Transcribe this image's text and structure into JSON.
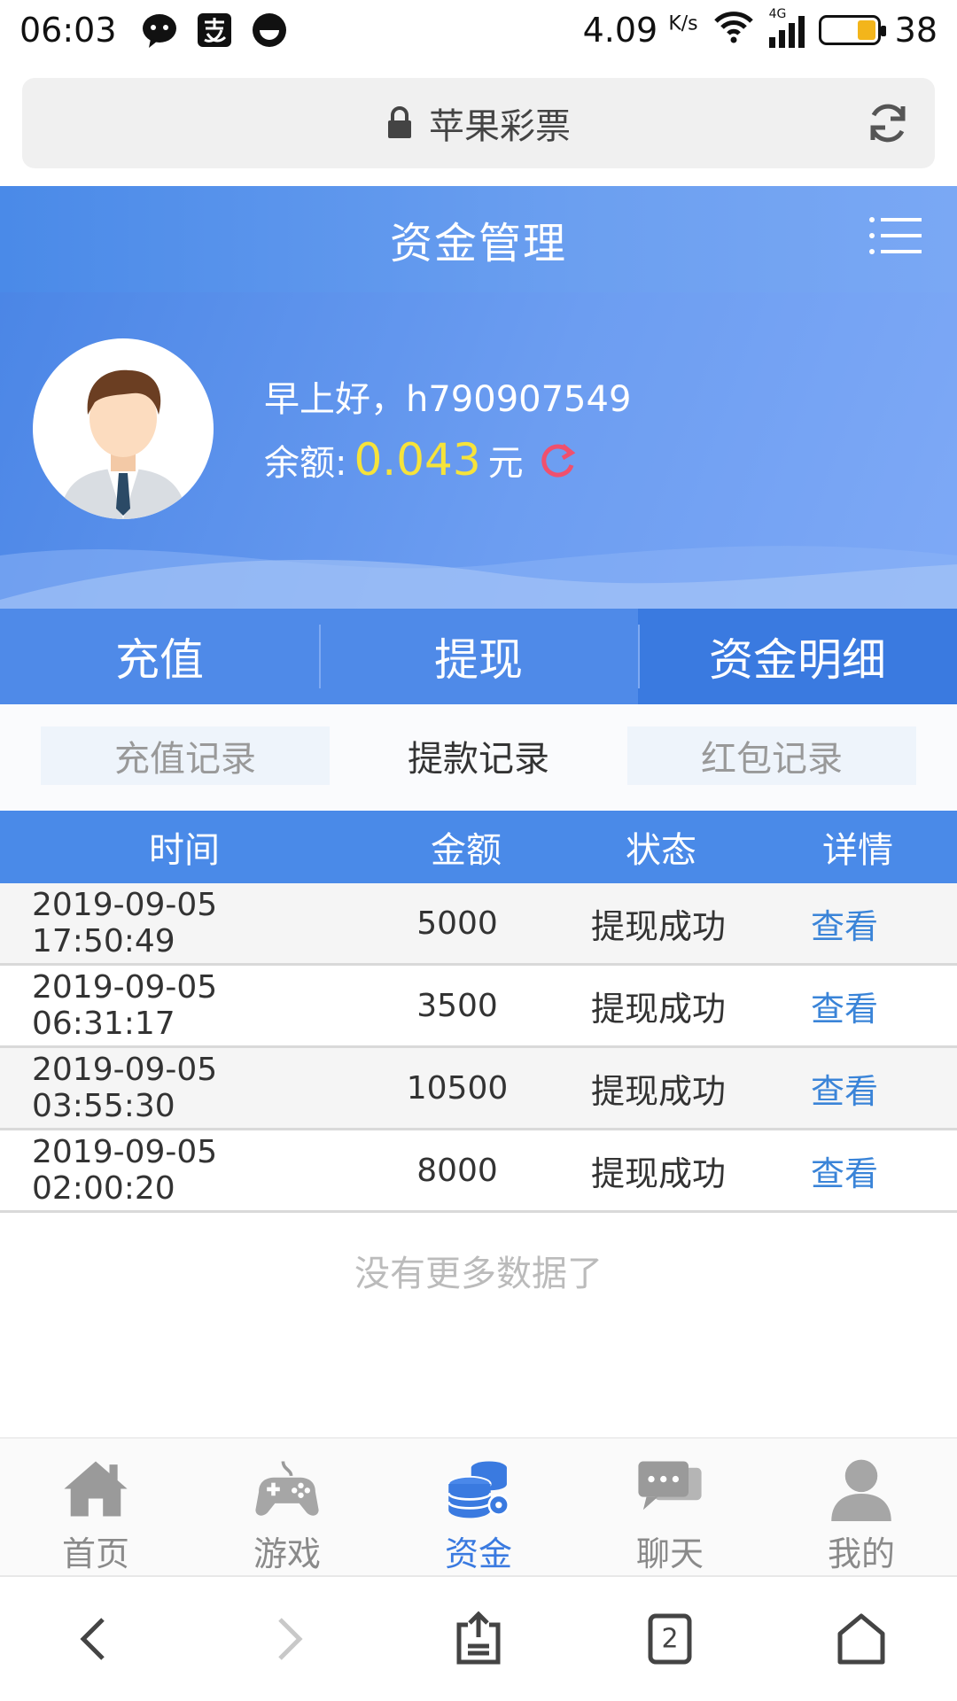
{
  "status_bar": {
    "time": "06:03",
    "speed": "4.09",
    "speed_unit": "K/s",
    "network": "4G",
    "battery": "38"
  },
  "browser": {
    "title": "苹果彩票"
  },
  "header": {
    "title": "资金管理"
  },
  "profile": {
    "greeting": "早上好，h790907549",
    "balance_label": "余额:",
    "balance_value": "0.043",
    "balance_unit": "元"
  },
  "fund_tabs": [
    {
      "label": "充值"
    },
    {
      "label": "提现"
    },
    {
      "label": "资金明细"
    }
  ],
  "record_tabs": [
    {
      "label": "充值记录"
    },
    {
      "label": "提款记录"
    },
    {
      "label": "红包记录"
    }
  ],
  "table": {
    "headers": [
      "时间",
      "金额",
      "状态",
      "详情"
    ],
    "rows": [
      {
        "time": "2019-09-05 17:50:49",
        "amount": "5000",
        "status": "提现成功",
        "detail": "查看"
      },
      {
        "time": "2019-09-05 06:31:17",
        "amount": "3500",
        "status": "提现成功",
        "detail": "查看"
      },
      {
        "time": "2019-09-05 03:55:30",
        "amount": "10500",
        "status": "提现成功",
        "detail": "查看"
      },
      {
        "time": "2019-09-05 02:00:20",
        "amount": "8000",
        "status": "提现成功",
        "detail": "查看"
      }
    ],
    "empty_note": "没有更多数据了"
  },
  "app_nav": [
    {
      "label": "首页",
      "icon": "home-icon"
    },
    {
      "label": "游戏",
      "icon": "gamepad-icon"
    },
    {
      "label": "资金",
      "icon": "coins-icon"
    },
    {
      "label": "聊天",
      "icon": "chat-icon"
    },
    {
      "label": "我的",
      "icon": "user-icon"
    }
  ],
  "browser_bar": {
    "tab_count": "2"
  },
  "colors": {
    "primary": "#4a8ae8",
    "active_tab": "#3a7ae0",
    "balance": "#f6e33a",
    "link": "#3a84d8"
  }
}
